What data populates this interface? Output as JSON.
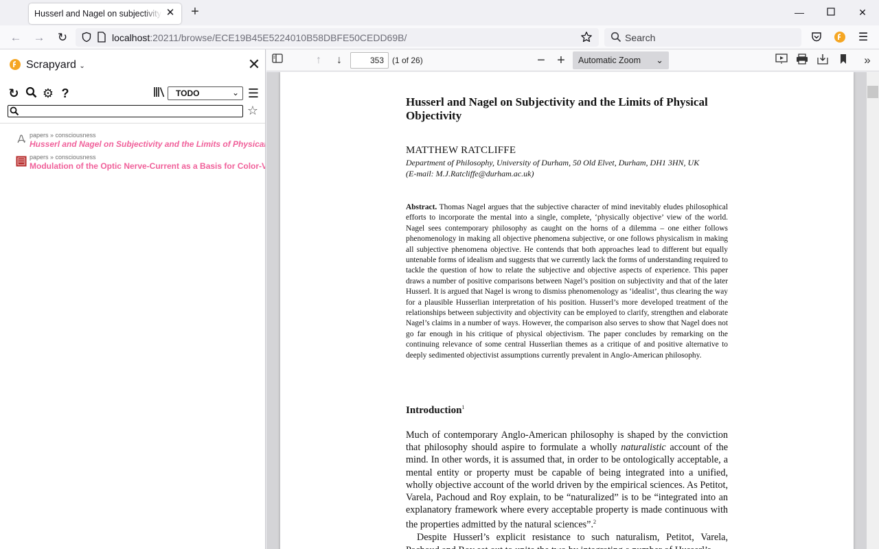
{
  "browser": {
    "tab_title": "Husserl and Nagel on subjectivity and the limits of physical objectivity",
    "url_host": "localhost",
    "url_rest": ":20211/browse/ECE19B45E5224010B58DBFE50CEDD69B/",
    "search_placeholder": "Search"
  },
  "sidebar": {
    "title": "Scrapyard",
    "shelf": "TODO",
    "items": [
      {
        "path": "papers » consciousness",
        "title": "Husserl and Nagel on Subjectivity and the Limits of Physical Objectivity",
        "icon": "pdf-icon"
      },
      {
        "path": "papers » consciousness",
        "title": "Modulation of the Optic Nerve-Current as a Basis for Color-Vision",
        "icon": "document-thumbnail-icon"
      }
    ]
  },
  "pdf": {
    "page_number": "353",
    "page_count": "(1 of 26)",
    "zoom": "Automatic Zoom",
    "title": "Husserl and Nagel on Subjectivity and the Limits of Physical Objectivity",
    "author": "MATTHEW RATCLIFFE",
    "affiliation_1": "Department of Philosophy, University of Durham, 50 Old Elvet, Durham, DH1 3HN, UK",
    "affiliation_2": "(E-mail: M.J.Ratcliffe@durham.ac.uk)",
    "abstract_label": "Abstract.",
    "abstract_text": "Thomas Nagel argues that the subjective character of mind inevitably eludes philosophical efforts to incorporate the mental into a single, complete, ‘physically objective’ view of the world. Nagel sees contemporary philosophy as caught on the horns of a dilemma – one either follows phenomenology in making all objective phenomena subjective, or one follows physicalism in making all subjective phenomena objective. He contends that both approaches lead to different but equally untenable forms of idealism and suggests that we currently lack the forms of understanding required to tackle the question of how to relate the subjective and objective aspects of experience. This paper draws a number of positive comparisons between Nagel’s position on subjectivity and that of the later Husserl. It is argued that Nagel is wrong to dismiss phenomenology as ‘idealist’, thus clearing the way for a plausible Husserlian interpretation of his position. Husserl’s more developed treatment of the relationships between subjectivity and objectivity can be employed to clarify, strengthen and elaborate Nagel’s claims in a number of ways. However, the comparison also serves to show that Nagel does not go far enough in his critique of physical objectivism. The paper concludes by remarking on the continuing relevance of some central Husserlian themes as a critique of and positive alternative to deeply sedimented objectivist assumptions currently prevalent in Anglo-American philosophy.",
    "intro_heading": "Introduction",
    "intro_footnote": "1",
    "body_p1_a": "Much of contemporary Anglo-American philosophy is shaped by the conviction that philosophy should aspire to formulate a wholly ",
    "body_p1_em": "naturalistic",
    "body_p1_b": " account of the mind. In other words, it is assumed that, in order to be ontologically acceptable, a mental entity or property must be capable of being integrated into a unified, wholly objective account of the world driven by the empirical sciences. As Petitot, Varela, Pachoud and Roy explain, to be “naturalized” is to be “integrated into an explanatory framework where every acceptable property is made continuous with the properties admitted by the natural sciences”.",
    "body_p1_note": "2",
    "body_p2": "Despite Husserl’s explicit resistance to such naturalism, Petitot, Varela, Pachoud and Roy set out to unite the two by integrating a number of Husserl’s"
  }
}
